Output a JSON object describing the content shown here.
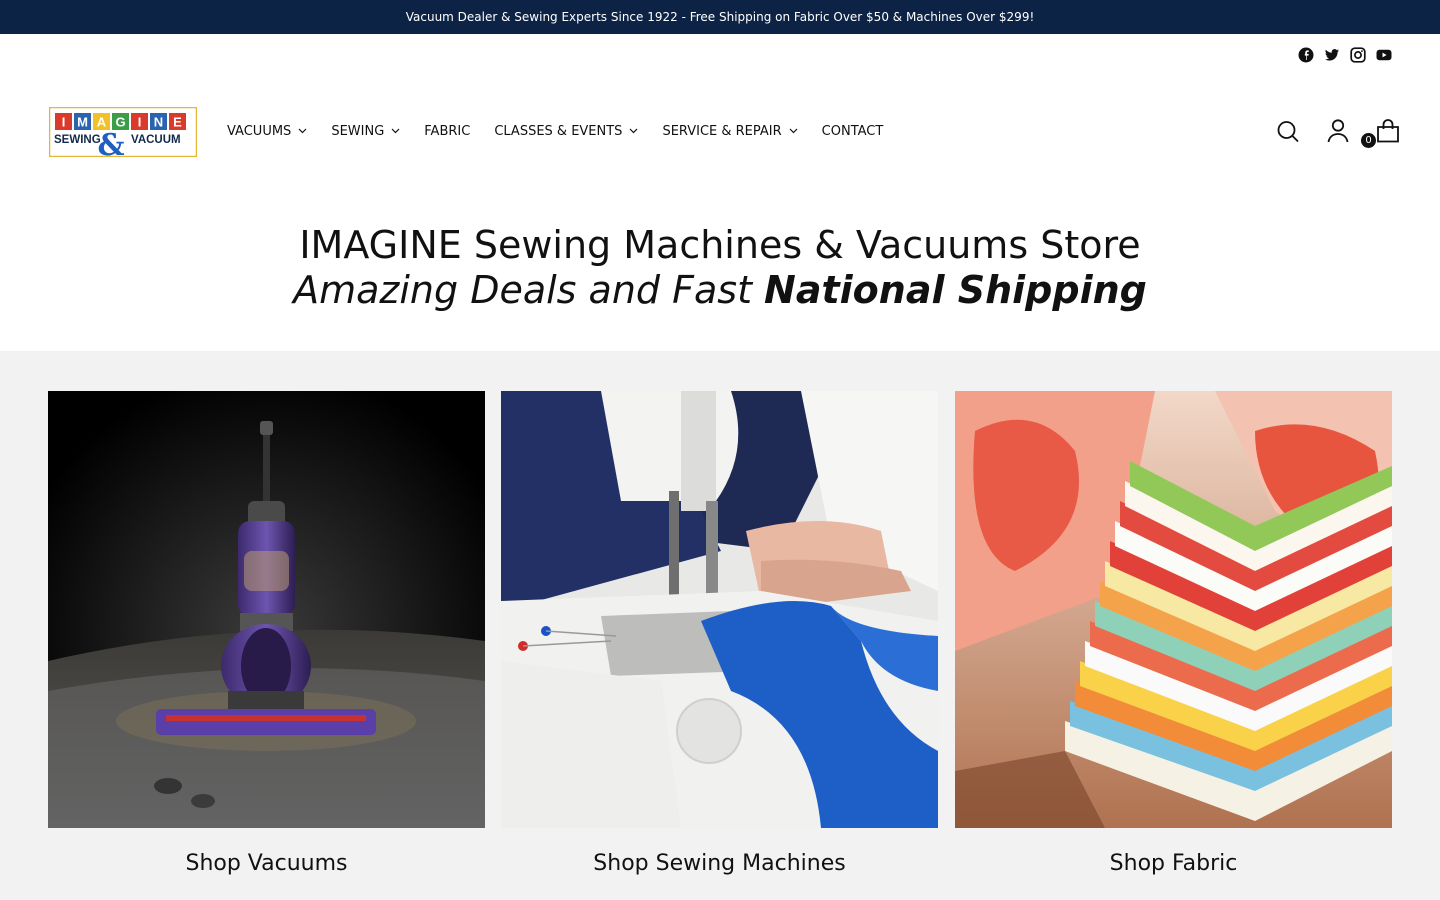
{
  "announcement": {
    "text": "Vacuum Dealer & Sewing Experts Since 1922 - Free Shipping on Fabric Over $50 & Machines Over $299!"
  },
  "social": [
    "facebook-icon",
    "twitter-icon",
    "instagram-icon",
    "youtube-icon"
  ],
  "logo": {
    "top_letters": [
      "I",
      "M",
      "A",
      "G",
      "I",
      "N",
      "E"
    ],
    "left_word": "SEWING",
    "right_word": "VACUUM",
    "ampersand": "&",
    "letter_colors": [
      "#d93a2b",
      "#2a64b0",
      "#f2c028",
      "#3c9d47",
      "#d93a2b",
      "#2a64b0",
      "#d93a2b"
    ]
  },
  "nav": {
    "items": [
      {
        "label": "VACUUMS",
        "dropdown": true
      },
      {
        "label": "SEWING",
        "dropdown": true
      },
      {
        "label": "FABRIC",
        "dropdown": false
      },
      {
        "label": "CLASSES & EVENTS",
        "dropdown": true
      },
      {
        "label": "SERVICE & REPAIR",
        "dropdown": true
      },
      {
        "label": "CONTACT",
        "dropdown": false
      }
    ]
  },
  "header_icons": {
    "search": "search-icon",
    "account": "account-icon",
    "cart": "cart-icon",
    "cart_count": "0"
  },
  "hero": {
    "title": "IMAGINE Sewing Machines & Vacuums Store",
    "subtitle_light": "Amazing Deals and Fast ",
    "subtitle_bold": "National Shipping"
  },
  "collections": [
    {
      "caption": "Shop Vacuums"
    },
    {
      "caption": "Shop Sewing Machines"
    },
    {
      "caption": "Shop Fabric"
    }
  ],
  "colors": {
    "announcement_bg": "#0d2346",
    "section_bg": "#f2f2f2",
    "accent_blue": "#1f5fbf"
  }
}
